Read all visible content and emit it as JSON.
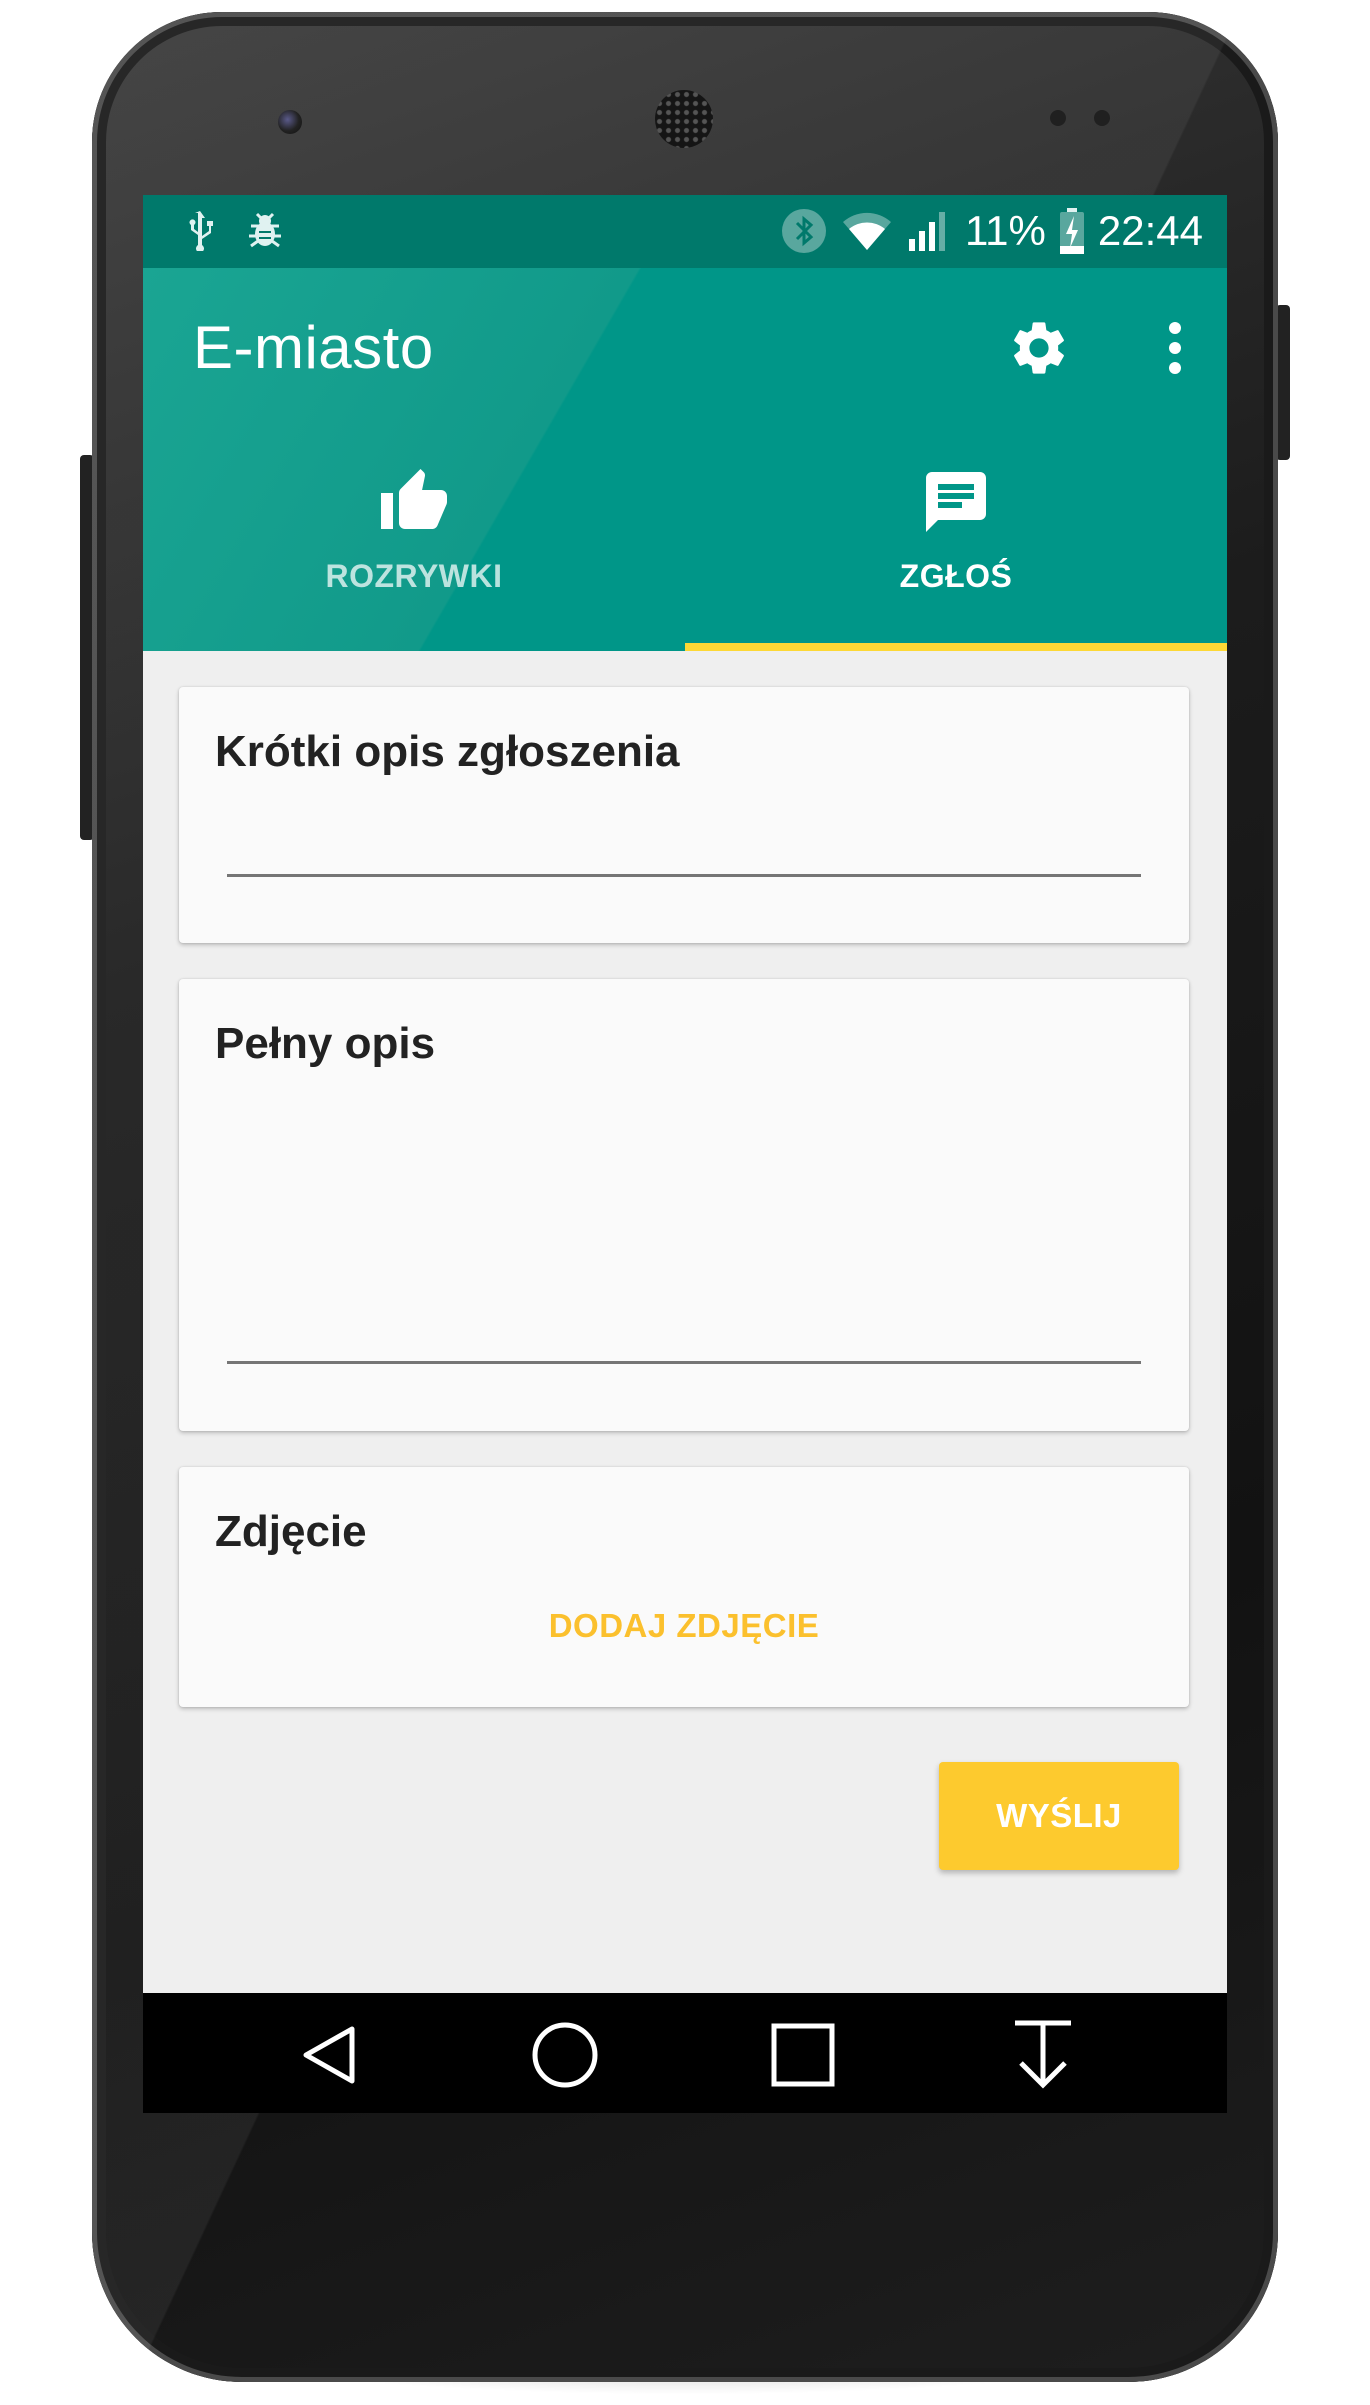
{
  "status_bar": {
    "battery_percent": "11%",
    "time": "22:44",
    "icons": [
      "usb-icon",
      "bug-icon",
      "bluetooth-icon",
      "wifi-icon",
      "signal-icon",
      "battery-charging-icon"
    ]
  },
  "app_bar": {
    "title": "E-miasto",
    "actions": [
      "gear-icon",
      "more-vert-icon"
    ]
  },
  "tabs": [
    {
      "label": "ROZRYWKI",
      "icon": "thumb-up-icon",
      "selected": false
    },
    {
      "label": "ZGŁOŚ",
      "icon": "chat-icon",
      "selected": true
    }
  ],
  "form": {
    "short_description": {
      "title": "Krótki opis zgłoszenia",
      "value": ""
    },
    "full_description": {
      "title": "Pełny opis",
      "value": ""
    },
    "photo": {
      "title": "Zdjęcie",
      "add_label": "DODAJ ZDJĘCIE"
    },
    "submit_label": "WYŚLIJ"
  },
  "nav_bar": {
    "buttons": [
      "back-icon",
      "home-icon",
      "recents-icon",
      "hide-keyboard-icon"
    ]
  },
  "colors": {
    "primary": "#009688",
    "primary_dark": "#00796b",
    "accent": "#fdd835",
    "button": "#fdca2e",
    "background": "#efefef",
    "card": "#fafafa"
  }
}
